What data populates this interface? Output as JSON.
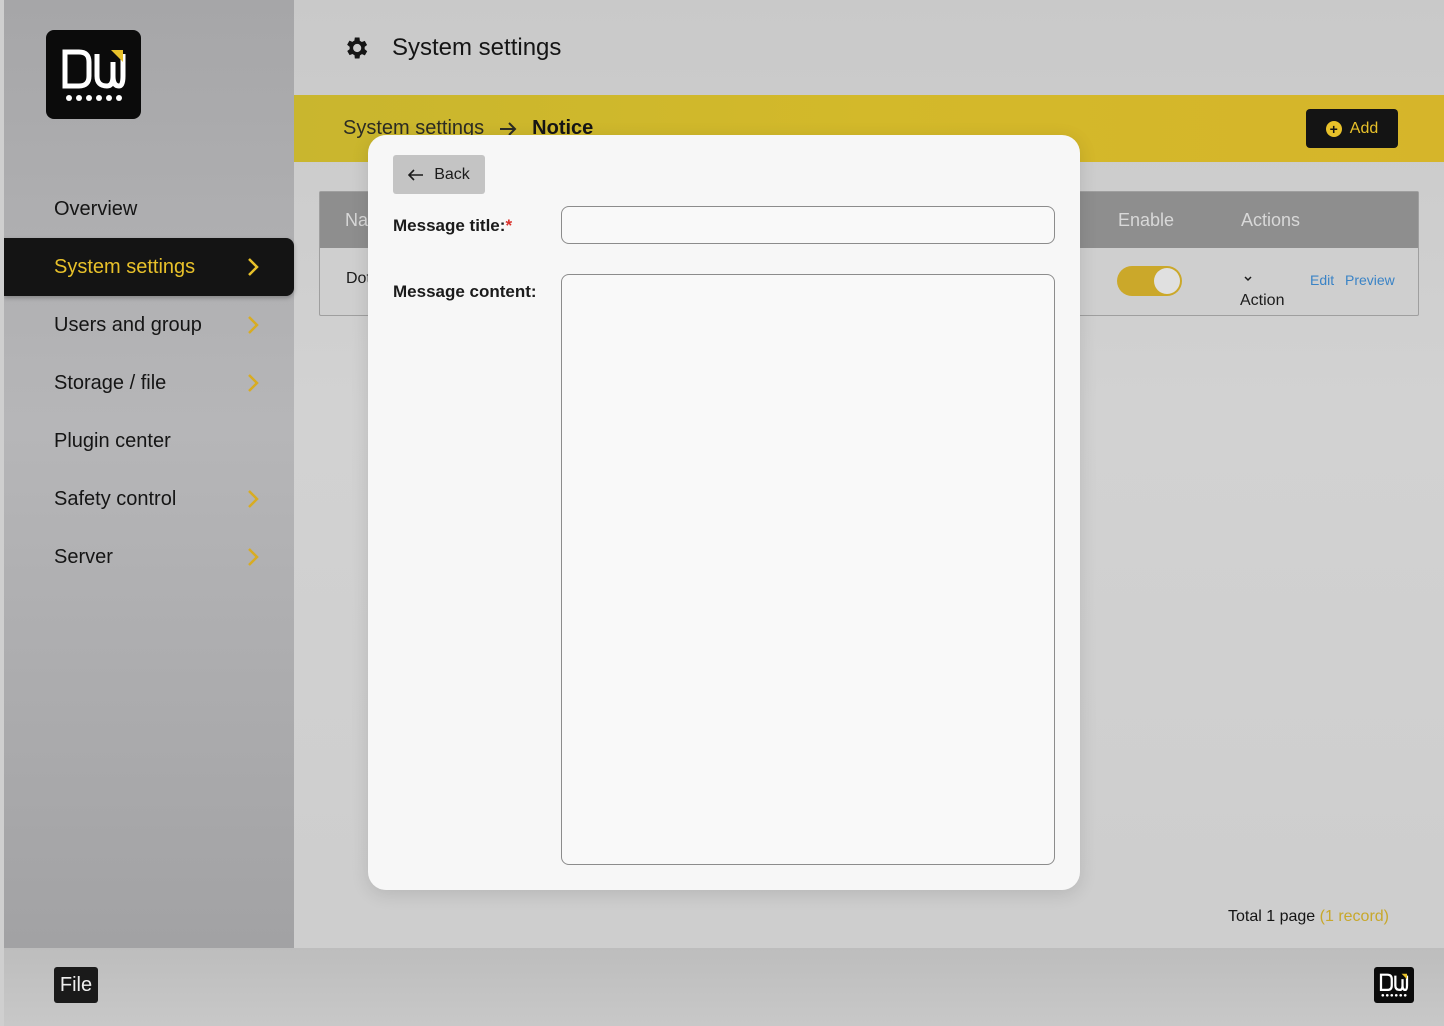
{
  "app": {
    "logo_icon": "dw-logo-icon"
  },
  "sidebar": {
    "items": [
      {
        "label": "Overview",
        "has_chevron": false,
        "active": false
      },
      {
        "label": "System settings",
        "has_chevron": true,
        "active": true
      },
      {
        "label": "Users and group",
        "has_chevron": true,
        "active": false
      },
      {
        "label": "Storage / file",
        "has_chevron": true,
        "active": false
      },
      {
        "label": "Plugin center",
        "has_chevron": false,
        "active": false
      },
      {
        "label": "Safety control",
        "has_chevron": true,
        "active": false
      },
      {
        "label": "Server",
        "has_chevron": true,
        "active": false
      }
    ]
  },
  "header": {
    "title": "System settings",
    "icon": "gear-icon"
  },
  "breadcrumb": {
    "parent": "System settings",
    "current": "Notice"
  },
  "toolbar": {
    "add_label": "Add"
  },
  "table": {
    "columns": {
      "name": "Na",
      "enable": "Enable",
      "actions": "Actions"
    },
    "rows": [
      {
        "name": "Dot",
        "enabled": true,
        "action_label": "Action",
        "edit_label": "Edit",
        "preview_label": "Preview"
      }
    ]
  },
  "pagination": {
    "total_text": "Total 1 page",
    "record_text": "(1 record)"
  },
  "bottom_bar": {
    "file_label": "File"
  },
  "modal": {
    "back_label": "Back",
    "title_label": "Message title:",
    "required_mark": "*",
    "content_label": "Message content:",
    "title_value": "",
    "content_value": ""
  },
  "colors": {
    "accent": "#e8c12a",
    "band": "#d3b92a",
    "link": "#3a83c6",
    "required": "#d9302a"
  }
}
